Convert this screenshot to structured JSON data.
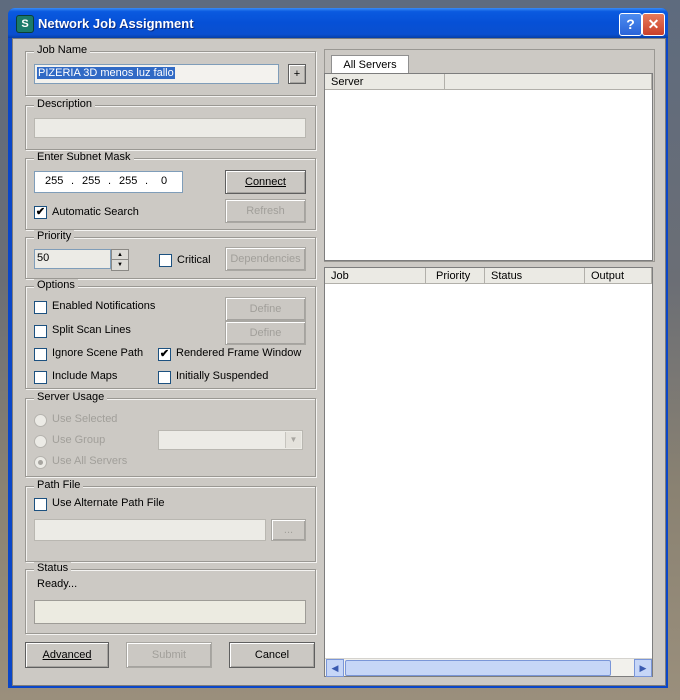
{
  "window": {
    "title": "Network Job Assignment",
    "help_glyph": "?",
    "close_glyph": "✕",
    "app_icon_letter": "S"
  },
  "job_name": {
    "title": "Job Name",
    "value": "PIZERIA 3D menos luz fallo",
    "plus_label": "+"
  },
  "description": {
    "title": "Description",
    "value": ""
  },
  "subnet": {
    "title": "Enter Subnet Mask",
    "octets": [
      "255",
      "255",
      "255",
      "0"
    ],
    "dot": ".",
    "connect_label": "Connect",
    "refresh_label": "Refresh",
    "auto_search_label": "Automatic Search",
    "auto_search_checked": true
  },
  "priority": {
    "title": "Priority",
    "value": "50",
    "critical_label": "Critical",
    "dependencies_label": "Dependencies"
  },
  "options": {
    "title": "Options",
    "enabled_notifications": "Enabled Notifications",
    "split_scan_lines": "Split Scan Lines",
    "define_label_1": "Define",
    "define_label_2": "Define",
    "ignore_scene_path": "Ignore Scene Path",
    "rendered_frame_window": "Rendered Frame Window",
    "rendered_frame_window_checked": true,
    "include_maps": "Include Maps",
    "initially_suspended": "Initially Suspended"
  },
  "server_usage": {
    "title": "Server Usage",
    "use_selected": "Use Selected",
    "use_group": "Use Group",
    "use_all_servers": "Use All Servers",
    "selected_option": "Use All Servers"
  },
  "path_file": {
    "title": "Path File",
    "use_alternate": "Use Alternate Path File",
    "browse_label": "...",
    "value": ""
  },
  "status": {
    "title": "Status",
    "text": "Ready..."
  },
  "footer": {
    "advanced": "Advanced",
    "submit": "Submit",
    "cancel": "Cancel"
  },
  "servers_panel": {
    "tab": "All Servers",
    "columns": [
      "Server",
      ""
    ]
  },
  "jobs_panel": {
    "columns": [
      "Job",
      "Priority",
      "Status",
      "Output"
    ],
    "scroll_left": "◀",
    "scroll_right": "▶"
  },
  "icons": {
    "dropdown": "chevron-down-icon",
    "check": "✔",
    "spin_up": "▲",
    "spin_down": "▼",
    "dropdown_glyph": "▼"
  }
}
